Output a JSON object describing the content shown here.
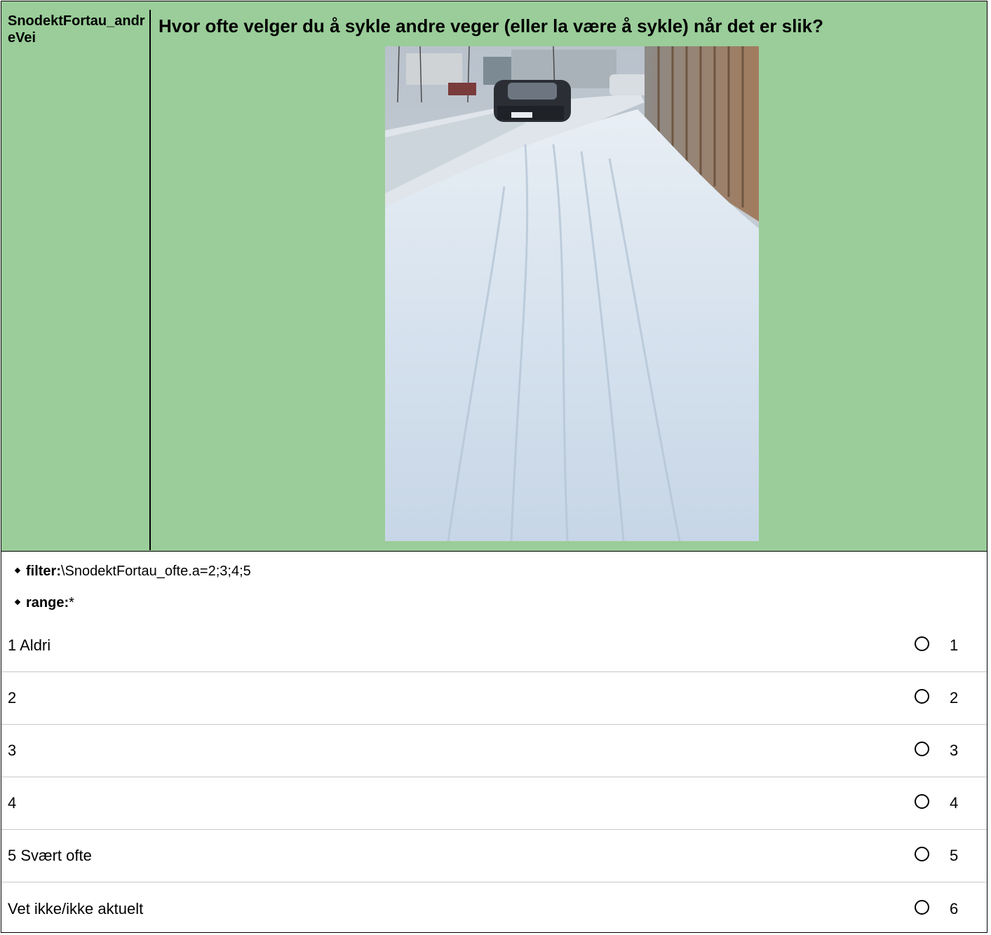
{
  "question": {
    "variable_name": "SnodektFortau_andreVei",
    "text": "Hvor ofte velger du å sykle andre veger (eller la være å sykle) når det er slik?"
  },
  "meta": {
    "filter_label": "filter:",
    "filter_value": "\\SnodektFortau_ofte.a=2;3;4;5",
    "range_label": "range:",
    "range_value": "*"
  },
  "options": [
    {
      "label": "1 Aldri",
      "code": "1"
    },
    {
      "label": "2",
      "code": "2"
    },
    {
      "label": "3",
      "code": "3"
    },
    {
      "label": "4",
      "code": "4"
    },
    {
      "label": "5 Svært ofte",
      "code": "5"
    },
    {
      "label": "Vet ikke/ikke aktuelt",
      "code": "6"
    }
  ],
  "colors": {
    "header_background": "#9acd99"
  }
}
